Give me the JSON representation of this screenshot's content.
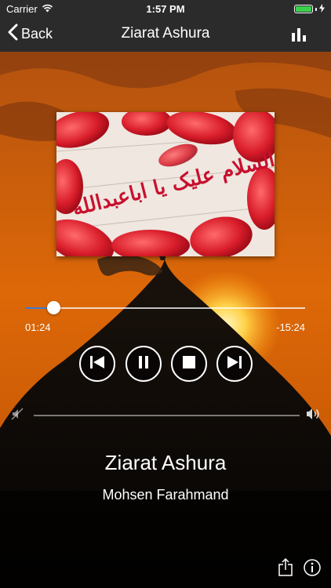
{
  "status_bar": {
    "carrier": "Carrier",
    "time": "1:57 PM",
    "battery_level": 1.0
  },
  "nav": {
    "back_label": "Back",
    "title": "Ziarat Ashura",
    "right_icon": "equalizer-icon"
  },
  "player": {
    "elapsed": "01:24",
    "remaining": "-15:24",
    "progress_fraction": 0.1,
    "track_title": "Ziarat Ashura",
    "artist": "Mohsen Farahmand",
    "controls": [
      "previous-icon",
      "pause-icon",
      "stop-icon",
      "next-icon"
    ]
  },
  "artwork": {
    "calligraphy_text": "السلام علیک یا اباعبدالله"
  },
  "toolbar": {
    "icons": [
      "share-icon",
      "info-icon"
    ]
  },
  "colors": {
    "bar": "#2b2b2b",
    "sky_top": "#c25a0c",
    "sky_bottom": "#e06a05",
    "accent": "#3a7bd5"
  }
}
